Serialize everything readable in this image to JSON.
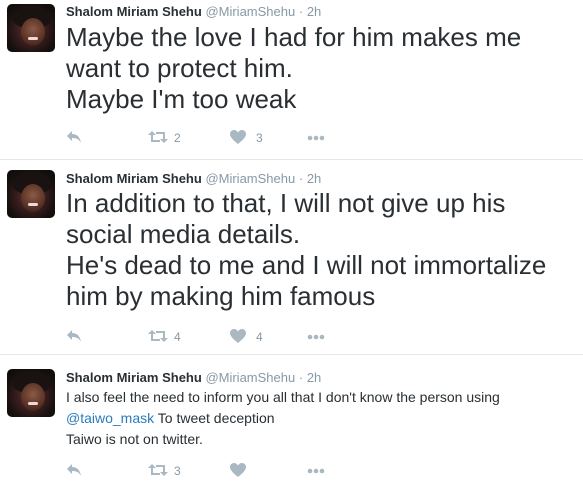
{
  "tweets": [
    {
      "author": {
        "name": "Shalom Miriam Shehu",
        "handle": "@MiriamShehu"
      },
      "time": "2h",
      "dot": "·",
      "lines": [
        "Maybe the love I had for him makes me",
        "want to protect him.",
        "Maybe I'm too weak"
      ],
      "retweets": "2",
      "likes": "3"
    },
    {
      "author": {
        "name": "Shalom Miriam Shehu",
        "handle": "@MiriamShehu"
      },
      "time": "2h",
      "dot": "·",
      "lines": [
        "In addition to that, I will not give up his",
        "social media details.",
        "He's dead to me and I will not immortalize",
        "him by making him famous"
      ],
      "retweets": "4",
      "likes": "4"
    },
    {
      "author": {
        "name": "Shalom Miriam Shehu",
        "handle": "@MiriamShehu"
      },
      "time": "2h",
      "dot": "·",
      "line1": "I also feel the need to inform you all that I don't know the person using",
      "mention": "@taiwo_mask",
      "line2_rest": " To tweet deception",
      "line3": "Taiwo is not on twitter.",
      "retweets": "3"
    }
  ],
  "icons": {
    "reply": "reply-icon",
    "retweet": "retweet-icon",
    "like": "heart-icon",
    "more": "more-icon"
  },
  "colors": {
    "text": "#292f33",
    "muted": "#8899a6",
    "link": "#2b7bb9",
    "icon": "#aab8c2",
    "divider": "#e1e8ed"
  }
}
